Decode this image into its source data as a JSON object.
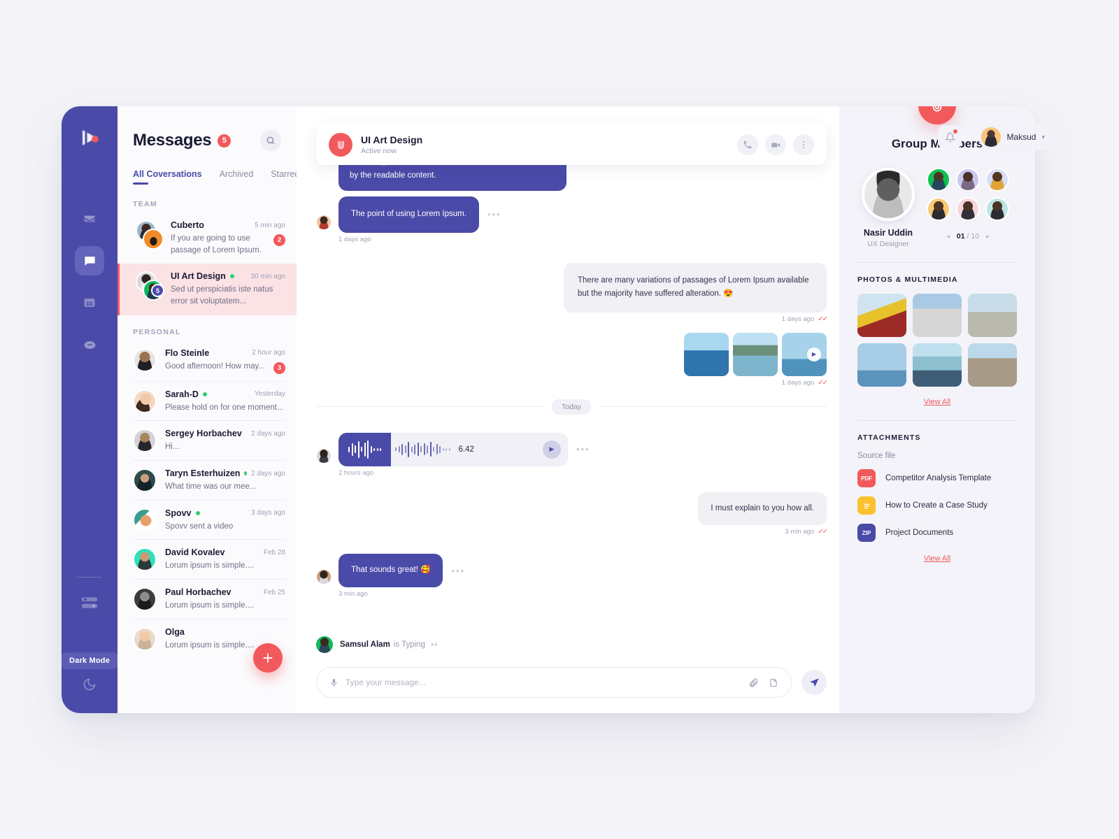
{
  "topbar": {
    "notification_icon": "bell-icon",
    "has_notification": true,
    "user_name": "Maksud",
    "chevron": "▾"
  },
  "rail": {
    "logo": "play-logo",
    "items": [
      {
        "name": "mail",
        "icon": "envelope-icon",
        "active": false
      },
      {
        "name": "chat",
        "icon": "chat-bubble-icon",
        "active": true
      },
      {
        "name": "apps",
        "icon": "grid-icon",
        "active": false
      },
      {
        "name": "emoji",
        "icon": "smiley-icon",
        "active": false
      }
    ],
    "settings_icon": "sliders-icon",
    "dark_mode_label": "Dark Mode",
    "moon_icon": "moon-icon"
  },
  "conversations": {
    "title": "Messages",
    "title_badge": "5",
    "search_icon": "search-icon",
    "tabs": [
      {
        "label": "All Coversations",
        "active": true
      },
      {
        "label": "Archived",
        "active": false
      },
      {
        "label": "Starred",
        "active": false
      }
    ],
    "groups": [
      {
        "label": "TEAM",
        "items": [
          {
            "name": "Cuberto",
            "time": "5 min ago",
            "preview": "If you are going to use passage of Lorem Ipsum.",
            "badge": "2",
            "online": false,
            "active": false,
            "double_avatar": true,
            "avatar_count": null
          },
          {
            "name": "UI Art Design",
            "time": "30 min ago",
            "preview": "Sed ut perspiciatis iste natus error sit voluptatem...",
            "badge": null,
            "online": true,
            "active": true,
            "double_avatar": true,
            "avatar_count": "5"
          }
        ]
      },
      {
        "label": "PERSONAL",
        "items": [
          {
            "name": "Flo Steinle",
            "time": "2 hour ago",
            "preview": "Good afternoon! How may...",
            "badge": "3",
            "online": false,
            "active": false,
            "double_avatar": false,
            "avatar_count": null
          },
          {
            "name": "Sarah-D",
            "time": "Yesterday",
            "preview": "Please hold on for one moment...",
            "badge": null,
            "online": true,
            "active": false,
            "double_avatar": false,
            "avatar_count": null
          },
          {
            "name": "Sergey Horbachev",
            "time": "2 days ago",
            "preview": "Hi...",
            "badge": null,
            "online": false,
            "active": false,
            "double_avatar": false,
            "avatar_count": null
          },
          {
            "name": "Taryn Esterhuizen",
            "time": "2 days ago",
            "preview": "What time was our mee...",
            "badge": null,
            "online": true,
            "active": false,
            "double_avatar": false,
            "avatar_count": null
          },
          {
            "name": "Spovv",
            "time": "3 days ago",
            "preview": "Spovv sent a video",
            "badge": null,
            "online": true,
            "active": false,
            "double_avatar": false,
            "avatar_count": null
          },
          {
            "name": "David Kovalev",
            "time": "Feb 28",
            "preview": "Lorum ipsum is simple....",
            "badge": null,
            "online": false,
            "active": false,
            "double_avatar": false,
            "avatar_count": null
          },
          {
            "name": "Paul Horbachev",
            "time": "Feb 25",
            "preview": "Lorum ipsum is simple....",
            "badge": null,
            "online": false,
            "active": false,
            "double_avatar": false,
            "avatar_count": null
          },
          {
            "name": "Olga",
            "time": "",
            "preview": "Lorum ipsum is simple....",
            "badge": null,
            "online": false,
            "active": false,
            "double_avatar": false,
            "avatar_count": null
          }
        ]
      }
    ],
    "new_chat_label": "+"
  },
  "chat": {
    "header": {
      "title": "UI Art Design",
      "status": "Active now",
      "actions": [
        {
          "name": "call",
          "icon": "phone-icon"
        },
        {
          "name": "video",
          "icon": "video-camera-icon"
        },
        {
          "name": "more",
          "icon": "more-vertical-icon"
        }
      ]
    },
    "messages": [
      {
        "type": "text",
        "side": "in",
        "text": "It is a long established fact that a reader will be distracted by the readable content.",
        "time": null
      },
      {
        "type": "text",
        "side": "in",
        "text": "The point of using Lorem Ipsum.",
        "time": "1 days ago"
      },
      {
        "type": "text",
        "side": "out",
        "text": "There are many variations of passages of Lorem Ipsum available but the majority have suffered alteration. 😍",
        "time": "1 days ago"
      },
      {
        "type": "gallery",
        "side": "out",
        "count": 3,
        "time": "1 days ago"
      },
      {
        "type": "divider",
        "label": "Today"
      },
      {
        "type": "voice",
        "side": "in",
        "duration": "6.42",
        "time": "2 hours ago"
      },
      {
        "type": "text",
        "side": "out",
        "text": "I must explain to you how all.",
        "time": "3 min ago"
      },
      {
        "type": "text",
        "side": "in",
        "text": "That sounds great! 🥰",
        "time": "3 min ago"
      }
    ],
    "typing": {
      "name": "Samsul Alam",
      "status": "is Typing"
    },
    "composer": {
      "mic_icon": "microphone-icon",
      "placeholder": "Type your message...",
      "value": "",
      "attach_icon": "paperclip-icon",
      "file_icon": "file-icon",
      "send_icon": "send-icon"
    }
  },
  "right_panel": {
    "group_logo": "group-logo",
    "title": "Group Members",
    "lead": {
      "name": "Nasir Uddin",
      "role": "UX Designer"
    },
    "pager": {
      "prev": "◂",
      "current": "01",
      "sep": "/",
      "total": "10",
      "next": "▸"
    },
    "photos_label": "PHOTOS & MULTIMEDIA",
    "photos_view_all": "View All",
    "attachments_label": "ATTACHMENTS",
    "source_file_label": "Source file",
    "attachments": [
      {
        "type": "PDF",
        "name": "Competitor Analysis Template",
        "color": "#f2595c"
      },
      {
        "type": "DOC",
        "name": "How to Create a Case Study",
        "color": "#fbc02d"
      },
      {
        "type": "ZIP",
        "name": "Project Documents",
        "color": "#4a4aa8"
      }
    ],
    "attachments_view_all": "View All"
  },
  "colors": {
    "primary": "#4a4aa8",
    "accent": "#f2595c",
    "online": "#2fcf6f",
    "panel": "#f3f3f9",
    "page_bg": "#f4f4f8"
  }
}
